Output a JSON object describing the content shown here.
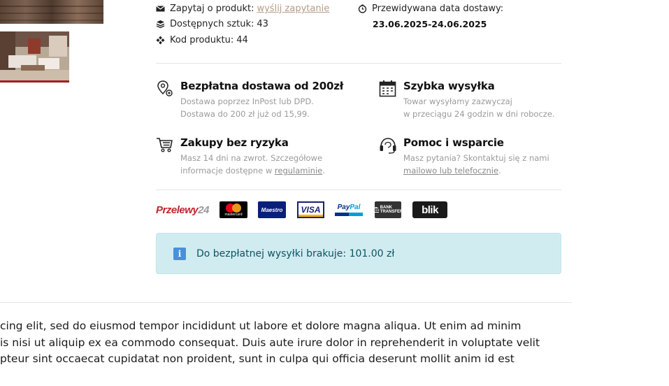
{
  "product_info": {
    "inquiry_label": "Zapytaj o produkt:",
    "inquiry_link": "wyślij zapytanie",
    "stock_label": "Dostępnych sztuk:",
    "stock_value": "43",
    "code_label": "Kod produktu:",
    "code_value": "44",
    "delivery_label": "Przewidywana data dostawy:",
    "delivery_date": "23.06.2025-24.06.2025"
  },
  "features": [
    {
      "icon": "location-icon",
      "title": "Bezpłatna dostawa od 200zł",
      "line1": "Dostawa poprzez InPost lub DPD.",
      "line2": "Dostawa do 200 zł już od 15,99."
    },
    {
      "icon": "calendar-icon",
      "title": "Szybka wysyłka",
      "line1": "Towar wysyłamy zazwyczaj",
      "line2": "w przeciągu 24 godzin w dni robocze."
    },
    {
      "icon": "cart-icon",
      "title": "Zakupy bez ryzyka",
      "line1": "Masz 14 dni na zwrot. Szczegółowe",
      "line2_prefix": "informacje dostępne w ",
      "line2_link": "regulaminie",
      "line2_suffix": "."
    },
    {
      "icon": "support-icon",
      "title": "Pomoc i wsparcie",
      "line1": "Masz pytania? Skontaktuj się z nami",
      "line2_link": "mailowo lub telefocznie",
      "line2_suffix": "."
    }
  ],
  "payments": {
    "p24_a": "Przelewy",
    "p24_b": "24",
    "mastercard": "mastercard",
    "maestro": "Maestro",
    "visa": "VISA",
    "paypal_a": "Pay",
    "paypal_b": "Pal",
    "bank_a": "BANK",
    "bank_b": "TRANSFER",
    "blik": "blik"
  },
  "alert": {
    "icon": "info-icon",
    "glyph": "i",
    "text": "Do bezpłatnej wysyłki brakuje: 101.00 zł"
  },
  "description": {
    "line1": "cing elit, sed do eiusmod tempor incididunt ut labore et dolore magna aliqua. Ut enim ad minim",
    "line2": "is nisi ut aliquip ex ea commodo consequat. Duis aute irure dolor in reprehenderit in voluptate velit",
    "line3": "pteur sint occaecat cupidatat non proident, sunt in culpa qui officia deserunt mollit anim id est"
  },
  "colors": {
    "accent_red": "#a11d22",
    "muted_link": "#b49c87",
    "alert_bg": "#d1ecf1",
    "alert_text": "#0c5460"
  }
}
